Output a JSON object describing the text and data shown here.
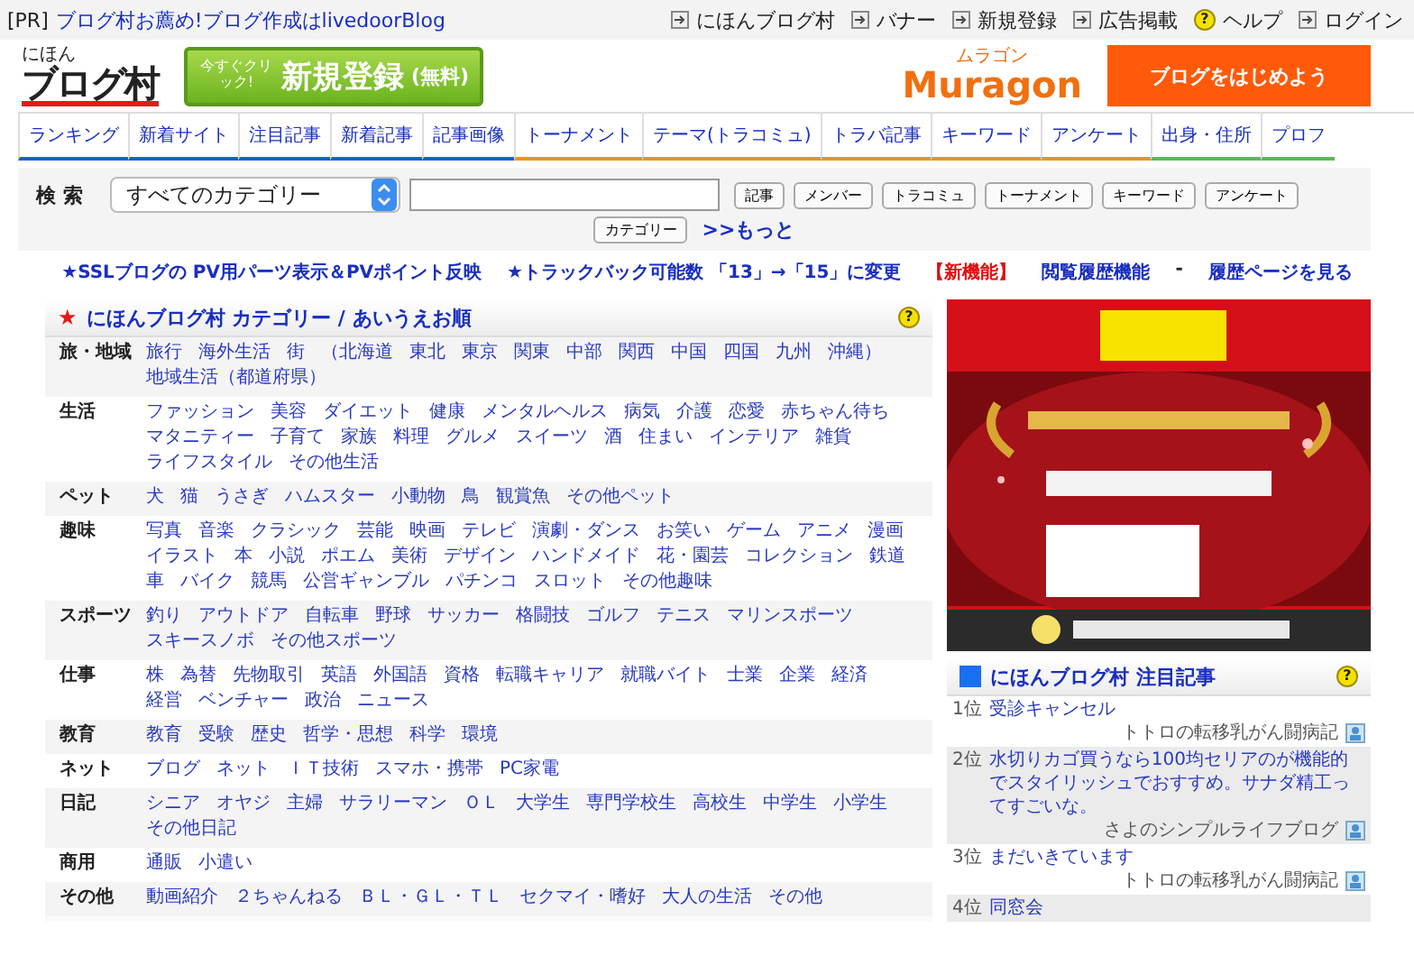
{
  "pr_bar": {
    "tag": "[PR]",
    "link": "ブログ村お薦め!ブログ作成はlivedoorBlog",
    "links": [
      {
        "label": "にほんブログ村",
        "kind": "arrow"
      },
      {
        "label": "バナー",
        "kind": "arrow"
      },
      {
        "label": "新規登録",
        "kind": "arrow"
      },
      {
        "label": "広告掲載",
        "kind": "arrow"
      },
      {
        "label": "ヘルプ",
        "kind": "help",
        "icon": "?"
      },
      {
        "label": "ログイン",
        "kind": "arrow"
      }
    ]
  },
  "header": {
    "logo_small": "にほん",
    "logo": "ブログ村",
    "signup_small": "今すぐクリック!",
    "signup": "新規登録",
    "signup_note": "(無料)",
    "muragon_small": "ムラゴン",
    "muragon": "Muragon",
    "start_button": "ブログをはじめよう"
  },
  "tabs": [
    {
      "label": "ランキング",
      "color": "#1a5fd6"
    },
    {
      "label": "新着サイト",
      "color": "#1a5fd6"
    },
    {
      "label": "注目記事",
      "color": "#1a5fd6"
    },
    {
      "label": "新着記事",
      "color": "#1a5fd6"
    },
    {
      "label": "記事画像",
      "color": "#1a5fd6"
    },
    {
      "label": "トーナメント",
      "color": "#f0921e"
    },
    {
      "label": "テーマ(トラコミュ)",
      "color": "#f0921e"
    },
    {
      "label": "トラバ記事",
      "color": "#f0921e"
    },
    {
      "label": "キーワード",
      "color": "#f0921e"
    },
    {
      "label": "アンケート",
      "color": "#f0921e"
    },
    {
      "label": "出身・住所",
      "color": "#5cb85c"
    },
    {
      "label": "プロフ",
      "color": "#5cb85c"
    }
  ],
  "search": {
    "label": "検 索",
    "category": "すべてのカテゴリー",
    "buttons": [
      "記事",
      "メンバー",
      "トラコミュ",
      "トーナメント",
      "キーワード",
      "アンケート",
      "カテゴリー"
    ],
    "more": ">>もっと"
  },
  "notices": [
    {
      "text": "★SSLブログの PV用パーツ表示＆PVポイント反映",
      "kind": "link"
    },
    {
      "text": "★トラックバック可能数 「13」→「15」に変更",
      "kind": "link"
    },
    {
      "text": "【新機能】",
      "kind": "alert"
    },
    {
      "text": "閲覧履歴機能",
      "kind": "link"
    },
    {
      "text": "-",
      "kind": "plain"
    },
    {
      "text": "履歴ページを見る",
      "kind": "link"
    }
  ],
  "categories": {
    "star": "★",
    "title": "にほんブログ村 カテゴリー / あいうえお順",
    "help": "?",
    "rows": [
      {
        "label": "旅・地域",
        "links": [
          "旅行",
          "海外生活",
          "街",
          "（北海道",
          "東北",
          "東京",
          "関東",
          "中部",
          "関西",
          "中国",
          "四国",
          "九州",
          "沖縄）",
          "地域生活（都道府県）"
        ]
      },
      {
        "label": "生活",
        "links": [
          "ファッション",
          "美容",
          "ダイエット",
          "健康",
          "メンタルヘルス",
          "病気",
          "介護",
          "恋愛",
          "赤ちゃん待ち",
          "マタニティー",
          "子育て",
          "家族",
          "料理",
          "グルメ",
          "スイーツ",
          "酒",
          "住まい",
          "インテリア",
          "雑貨",
          "ライフスタイル",
          "その他生活"
        ]
      },
      {
        "label": "ペット",
        "links": [
          "犬",
          "猫",
          "うさぎ",
          "ハムスター",
          "小動物",
          "鳥",
          "観賞魚",
          "その他ペット"
        ]
      },
      {
        "label": "趣味",
        "links": [
          "写真",
          "音楽",
          "クラシック",
          "芸能",
          "映画",
          "テレビ",
          "演劇・ダンス",
          "お笑い",
          "ゲーム",
          "アニメ",
          "漫画",
          "イラスト",
          "本",
          "小説",
          "ポエム",
          "美術",
          "デザイン",
          "ハンドメイド",
          "花・園芸",
          "コレクション",
          "鉄道",
          "車",
          "バイク",
          "競馬",
          "公営ギャンブル",
          "パチンコ",
          "スロット",
          "その他趣味"
        ]
      },
      {
        "label": "スポーツ",
        "links": [
          "釣り",
          "アウトドア",
          "自転車",
          "野球",
          "サッカー",
          "格闘技",
          "ゴルフ",
          "テニス",
          "マリンスポーツ",
          "スキースノボ",
          "その他スポーツ"
        ]
      },
      {
        "label": "仕事",
        "links": [
          "株",
          "為替",
          "先物取引",
          "英語",
          "外国語",
          "資格",
          "転職キャリア",
          "就職バイト",
          "士業",
          "企業",
          "経済",
          "経営",
          "ベンチャー",
          "政治",
          "ニュース"
        ]
      },
      {
        "label": "教育",
        "links": [
          "教育",
          "受験",
          "歴史",
          "哲学・思想",
          "科学",
          "環境"
        ]
      },
      {
        "label": "ネット",
        "links": [
          "ブログ",
          "ネット",
          "ＩＴ技術",
          "スマホ・携帯",
          "PC家電"
        ]
      },
      {
        "label": "日記",
        "links": [
          "シニア",
          "オヤジ",
          "主婦",
          "サラリーマン",
          "ＯＬ",
          "大学生",
          "専門学校生",
          "高校生",
          "中学生",
          "小学生",
          "その他日記"
        ]
      },
      {
        "label": "商用",
        "links": [
          "通販",
          "小遣い"
        ]
      },
      {
        "label": "その他",
        "links": [
          "動画紹介",
          "２ちゃんねる",
          "ＢＬ・ＧＬ・ＴＬ",
          "セクマイ・嗜好",
          "大人の生活",
          "その他"
        ]
      }
    ]
  },
  "featured": {
    "title": "にほんブログ村 注目記事",
    "help": "?",
    "items": [
      {
        "rank": "1位",
        "title": "受診キャンセル",
        "author": "トトロの転移乳がん闘病記"
      },
      {
        "rank": "2位",
        "title": "水切りカゴ買うなら100均セリアのが機能的でスタイリッシュでおすすめ。サナダ精工ってすごいな。",
        "author": "さよのシンプルライフブログ"
      },
      {
        "rank": "3位",
        "title": "まだいきています",
        "author": "トトロの転移乳がん闘病記"
      },
      {
        "rank": "4位",
        "title": "同窓会"
      }
    ]
  }
}
